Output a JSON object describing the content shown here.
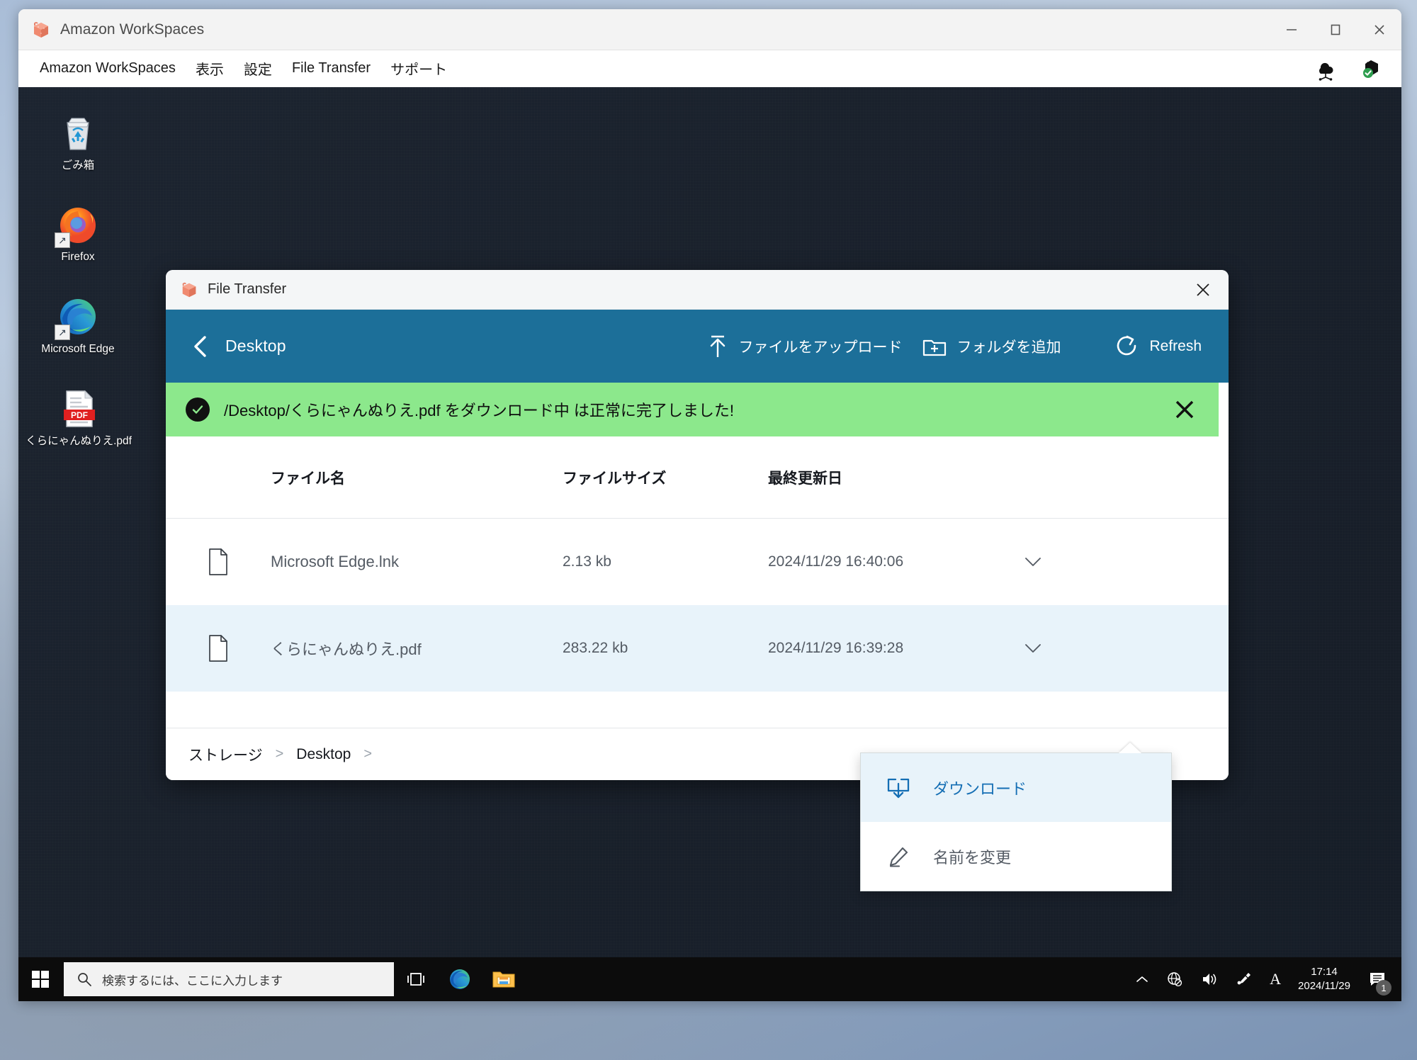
{
  "client_window": {
    "title": "Amazon WorkSpaces",
    "logo_icon": "workspaces-cube-icon",
    "menu_items": [
      {
        "label": "Amazon WorkSpaces",
        "name": "menu-amazon-workspaces"
      },
      {
        "label": "表示",
        "name": "menu-view"
      },
      {
        "label": "設定",
        "name": "menu-settings"
      },
      {
        "label": "File Transfer",
        "name": "menu-file-transfer"
      },
      {
        "label": "サポート",
        "name": "menu-support"
      }
    ],
    "tray_icons": [
      {
        "name": "network-cloud-icon",
        "label": "cloud-status"
      },
      {
        "name": "shield-check-icon",
        "label": "connection-secure"
      }
    ],
    "window_controls": {
      "minimize": "—",
      "maximize": "▢",
      "close": "✕"
    }
  },
  "desktop": {
    "icons": [
      {
        "label": "ごみ箱",
        "icon": "recycle-bin-icon",
        "shortcut": false
      },
      {
        "label": "Firefox",
        "icon": "firefox-icon",
        "shortcut": true
      },
      {
        "label": "Microsoft Edge",
        "icon": "microsoft-edge-icon",
        "shortcut": true
      },
      {
        "label": "くらにゃんぬりえ.pdf",
        "icon": "pdf-file-icon",
        "shortcut": false
      }
    ]
  },
  "file_transfer": {
    "title": "File Transfer",
    "logo_icon": "workspaces-cube-icon",
    "close_icon": "close-icon",
    "toolbar": {
      "back_icon": "chevron-left-icon",
      "current_directory": "Desktop",
      "upload_label": "ファイルをアップロード",
      "upload_icon": "upload-arrow-icon",
      "add_folder_label": "フォルダを追加",
      "add_folder_icon": "folder-plus-icon",
      "refresh_label": "Refresh",
      "refresh_icon": "refresh-icon",
      "accent_color": "#1c6f99"
    },
    "banner": {
      "icon": "check-circle-icon",
      "message": "/Desktop/くらにゃんぬりえ.pdf をダウンロード中 は正常に完了しました!",
      "dismiss_icon": "close-icon",
      "background_color": "#8ce88c"
    },
    "table": {
      "headers": {
        "name": "ファイル名",
        "size": "ファイルサイズ",
        "modified": "最終更新日"
      },
      "rows": [
        {
          "icon": "file-icon",
          "name": "Microsoft Edge.lnk",
          "size": "2.13 kb",
          "modified": "2024/11/29 16:40:06",
          "menu_icon": "chevron-down-icon",
          "selected": false
        },
        {
          "icon": "file-icon",
          "name": "くらにゃんぬりえ.pdf",
          "size": "283.22 kb",
          "modified": "2024/11/29 16:39:28",
          "menu_icon": "chevron-down-icon",
          "selected": true
        }
      ]
    },
    "context_menu": {
      "items": [
        {
          "label": "ダウンロード",
          "icon": "download-folder-icon",
          "highlighted": true
        },
        {
          "label": "名前を変更",
          "icon": "pencil-edit-icon",
          "highlighted": false
        }
      ]
    },
    "breadcrumb": {
      "root": "ストレージ",
      "sep1": ">",
      "current": "Desktop",
      "sep2": ">"
    }
  },
  "taskbar": {
    "start_icon": "windows-start-icon",
    "search_placeholder": "検索するには、ここに入力します",
    "search_icon": "search-icon",
    "pinned": [
      {
        "name": "task-view-icon",
        "label": "task-view"
      },
      {
        "name": "microsoft-edge-icon",
        "label": "Microsoft Edge"
      },
      {
        "name": "file-explorer-icon",
        "label": "File Explorer"
      }
    ],
    "tray": [
      {
        "name": "chevron-up-icon"
      },
      {
        "name": "network-globe-blocked-icon"
      },
      {
        "name": "volume-icon"
      },
      {
        "name": "ime-pen-icon"
      },
      {
        "name": "ime-alphanumeric-icon"
      }
    ],
    "clock_time": "17:14",
    "clock_date": "2024/11/29",
    "notification_icon": "notifications-icon",
    "notification_count": "1"
  }
}
